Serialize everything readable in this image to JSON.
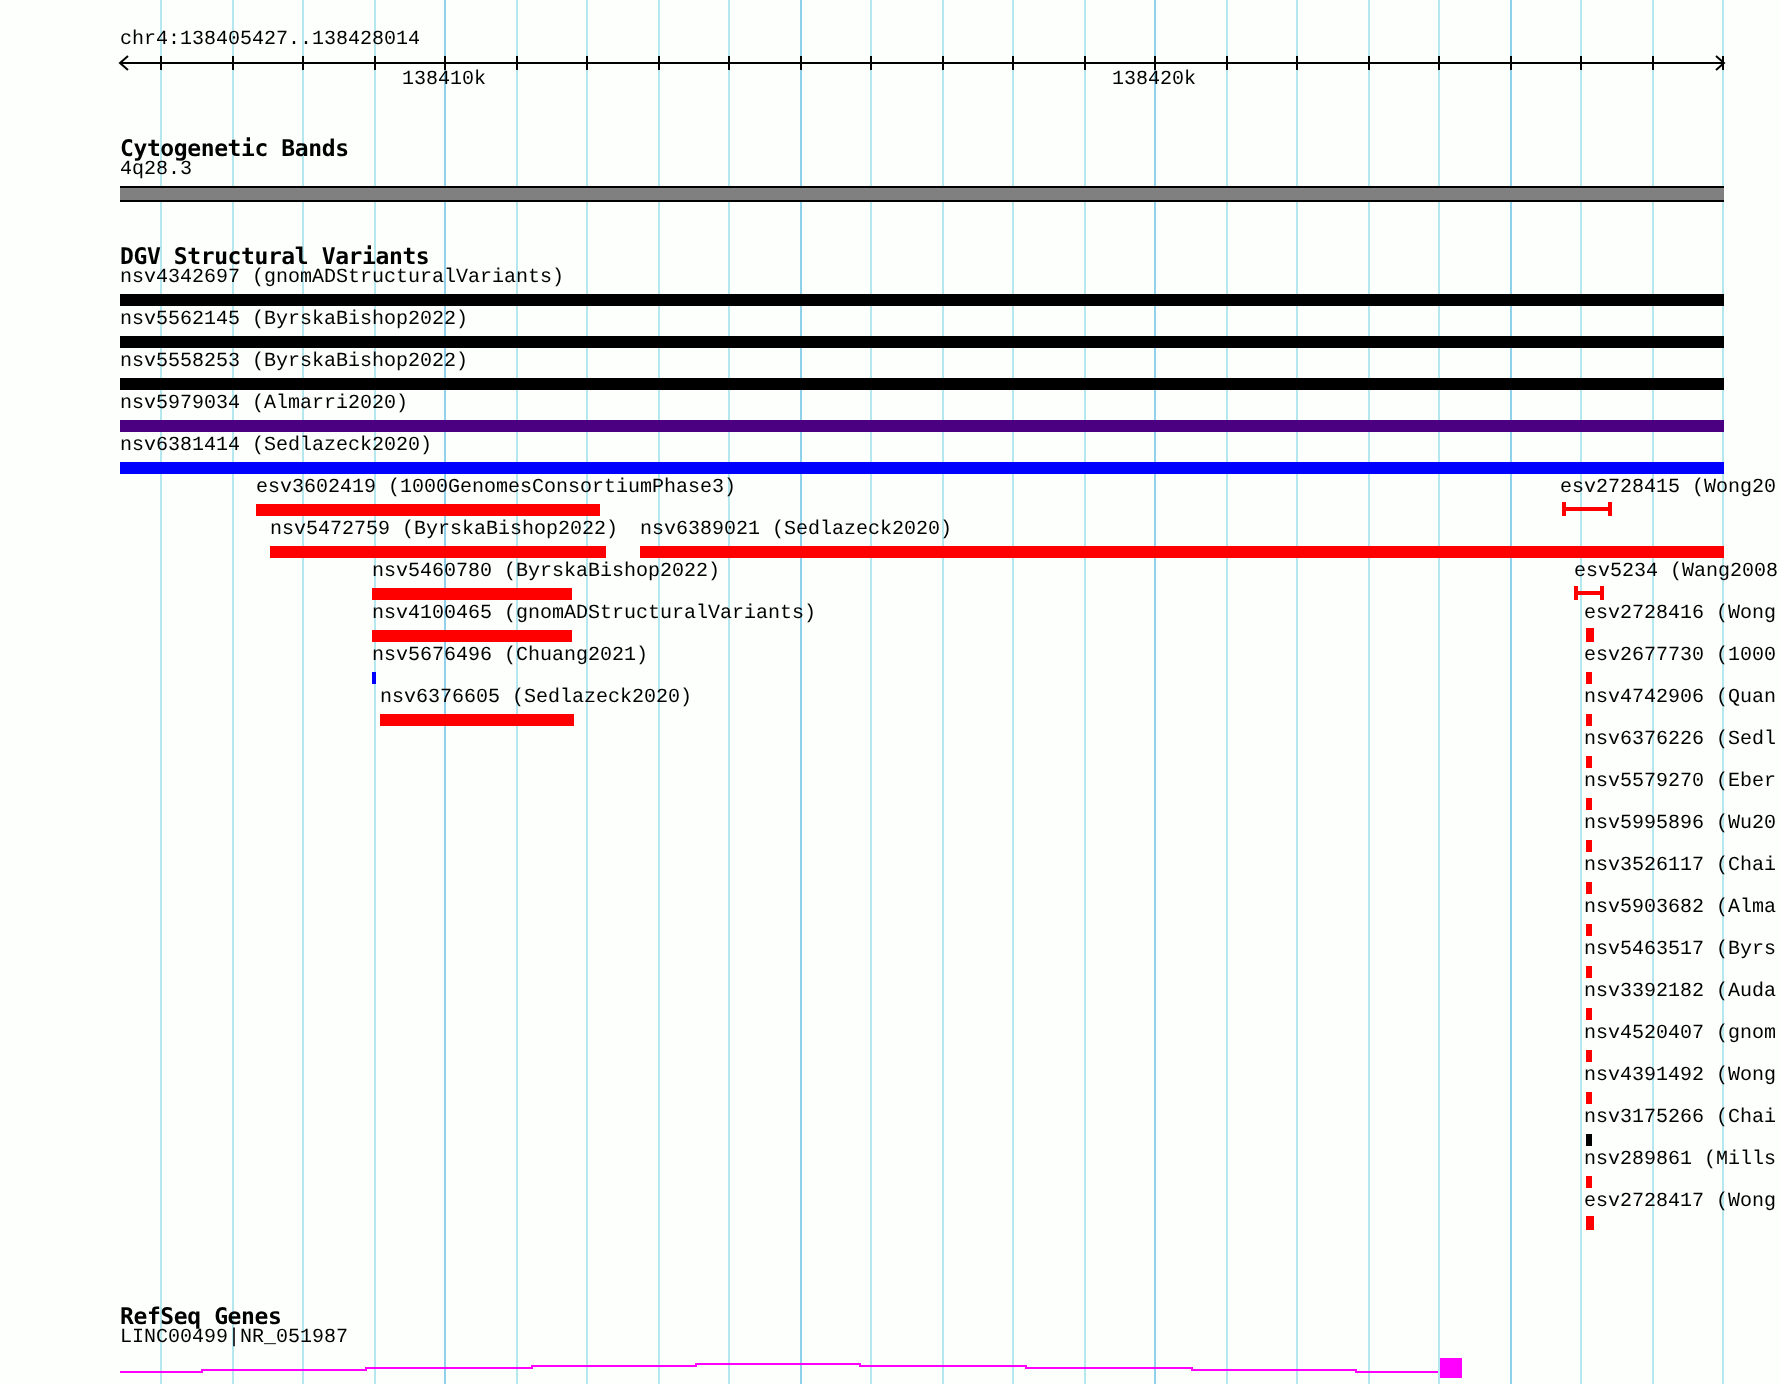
{
  "location": "chr4:138405427..138428014",
  "ruler": {
    "ticks": [
      "138410k",
      "138420k"
    ]
  },
  "tracks": [
    {
      "title": "Cytogenetic Bands",
      "features": [
        {
          "label": "4q28.3",
          "kind": "band",
          "color": "#808080"
        }
      ]
    },
    {
      "title": "DGV Structural Variants",
      "features": [
        {
          "label": "nsv4342697 (gnomADStructuralVariants)",
          "kind": "bar",
          "color": "#000000"
        },
        {
          "label": "nsv5562145 (ByrskaBishop2022)",
          "kind": "bar",
          "color": "#000000"
        },
        {
          "label": "nsv5558253 (ByrskaBishop2022)",
          "kind": "bar",
          "color": "#000000"
        },
        {
          "label": "nsv5979034 (Almarri2020)",
          "kind": "bar",
          "color": "#4b0082"
        },
        {
          "label": "nsv6381414 (Sedlazeck2020)",
          "kind": "bar",
          "color": "#0000ff"
        },
        {
          "label": "esv3602419 (1000GenomesConsortiumPhase3)",
          "kind": "bar",
          "color": "#ff0000"
        },
        {
          "label": "nsv5472759 (ByrskaBishop2022)",
          "kind": "bar",
          "color": "#ff0000"
        },
        {
          "label": "nsv6389021 (Sedlazeck2020)",
          "kind": "bar",
          "color": "#ff0000"
        },
        {
          "label": "nsv5460780 (ByrskaBishop2022)",
          "kind": "bar",
          "color": "#ff0000"
        },
        {
          "label": "nsv4100465 (gnomADStructuralVariants)",
          "kind": "bar",
          "color": "#ff0000"
        },
        {
          "label": "nsv5676496 (Chuang2021)",
          "kind": "bar",
          "color": "#0000ff"
        },
        {
          "label": "nsv6376605 (Sedlazeck2020)",
          "kind": "bar",
          "color": "#ff0000"
        },
        {
          "label": "esv2728415 (Wong20",
          "kind": "interval",
          "color": "#ff0000"
        },
        {
          "label": "esv5234 (Wang2008",
          "kind": "interval",
          "color": "#ff0000"
        },
        {
          "label": "esv2728416 (Wong",
          "kind": "interval",
          "color": "#ff0000"
        },
        {
          "label": "esv2677730 (1000",
          "kind": "bar",
          "color": "#ff0000"
        },
        {
          "label": "nsv4742906 (Quan",
          "kind": "bar",
          "color": "#ff0000"
        },
        {
          "label": "nsv6376226 (Sedl",
          "kind": "bar",
          "color": "#ff0000"
        },
        {
          "label": "nsv5579270 (Eber",
          "kind": "bar",
          "color": "#ff0000"
        },
        {
          "label": "nsv5995896 (Wu20",
          "kind": "bar",
          "color": "#ff0000"
        },
        {
          "label": "nsv3526117 (Chai",
          "kind": "bar",
          "color": "#ff0000"
        },
        {
          "label": "nsv5903682 (Alma",
          "kind": "bar",
          "color": "#ff0000"
        },
        {
          "label": "nsv5463517 (Byrs",
          "kind": "bar",
          "color": "#ff0000"
        },
        {
          "label": "nsv3392182 (Auda",
          "kind": "bar",
          "color": "#ff0000"
        },
        {
          "label": "nsv4520407 (gnom",
          "kind": "bar",
          "color": "#ff0000"
        },
        {
          "label": "nsv4391492 (Wong",
          "kind": "bar",
          "color": "#ff0000"
        },
        {
          "label": "nsv3175266 (Chai",
          "kind": "bar",
          "color": "#000000"
        },
        {
          "label": "nsv289861 (Mills",
          "kind": "bar",
          "color": "#ff0000"
        },
        {
          "label": "esv2728417 (Wong",
          "kind": "interval",
          "color": "#ff0000"
        }
      ]
    },
    {
      "title": "RefSeq Genes",
      "features": [
        {
          "label": "LINC00499|NR_051987",
          "kind": "gene",
          "color": "#ff00ff"
        }
      ]
    }
  ]
}
